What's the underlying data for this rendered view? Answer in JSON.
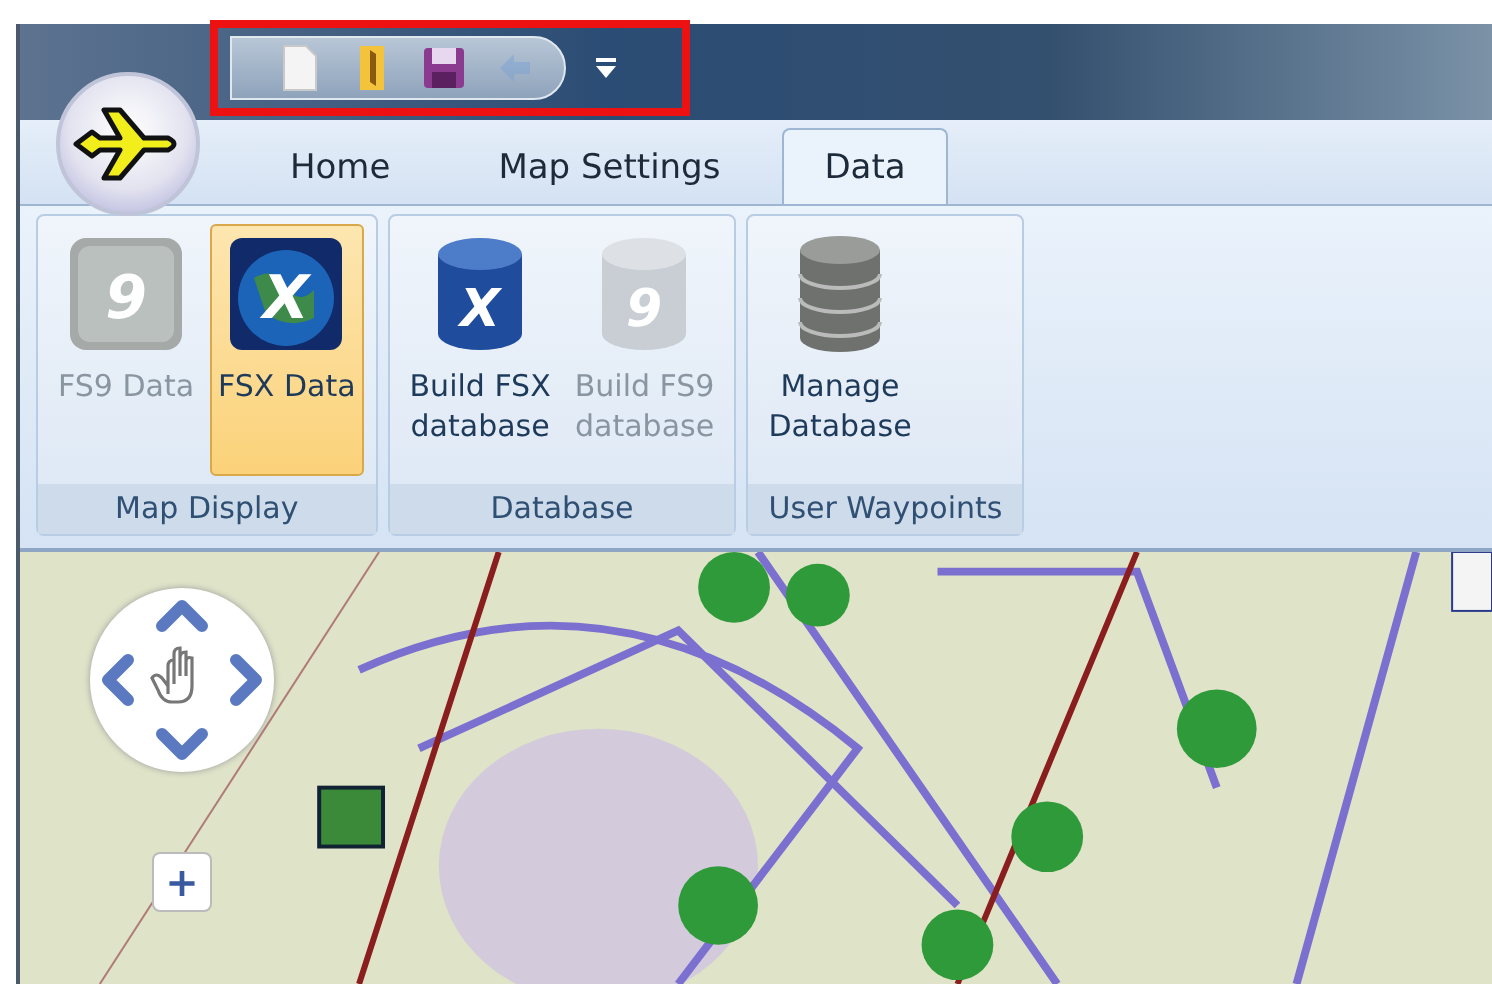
{
  "app_button": {
    "kind": "plane"
  },
  "quick_access_toolbar": {
    "highlighted": true,
    "buttons": [
      {
        "kind": "new",
        "disabled": false
      },
      {
        "kind": "open",
        "disabled": false
      },
      {
        "kind": "save",
        "disabled": false
      },
      {
        "kind": "sync",
        "disabled": true
      }
    ]
  },
  "tabs": [
    {
      "label": "Home",
      "selected": false
    },
    {
      "label": "Map Settings",
      "selected": false
    },
    {
      "label": "Data",
      "selected": true
    }
  ],
  "groups": [
    {
      "label": "Map Display",
      "buttons": [
        {
          "label": "FS9 Data",
          "kind": "globe",
          "glyph": "9",
          "disabled": true,
          "selected": false
        },
        {
          "label": "FSX Data",
          "kind": "globe",
          "glyph": "X",
          "disabled": false,
          "selected": true
        }
      ]
    },
    {
      "label": "Database",
      "buttons": [
        {
          "label": "Build FSX\ndatabase",
          "kind": "cylinder",
          "glyph": "X",
          "disabled": false
        },
        {
          "label": "Build FS9\ndatabase",
          "kind": "cylinder",
          "glyph": "9",
          "disabled": true
        }
      ]
    },
    {
      "label": "User Waypoints",
      "buttons": [
        {
          "label": "Manage\nDatabase",
          "kind": "stack",
          "disabled": false
        }
      ]
    }
  ],
  "map": {
    "kind": "picture",
    "zoom_in": "+"
  }
}
